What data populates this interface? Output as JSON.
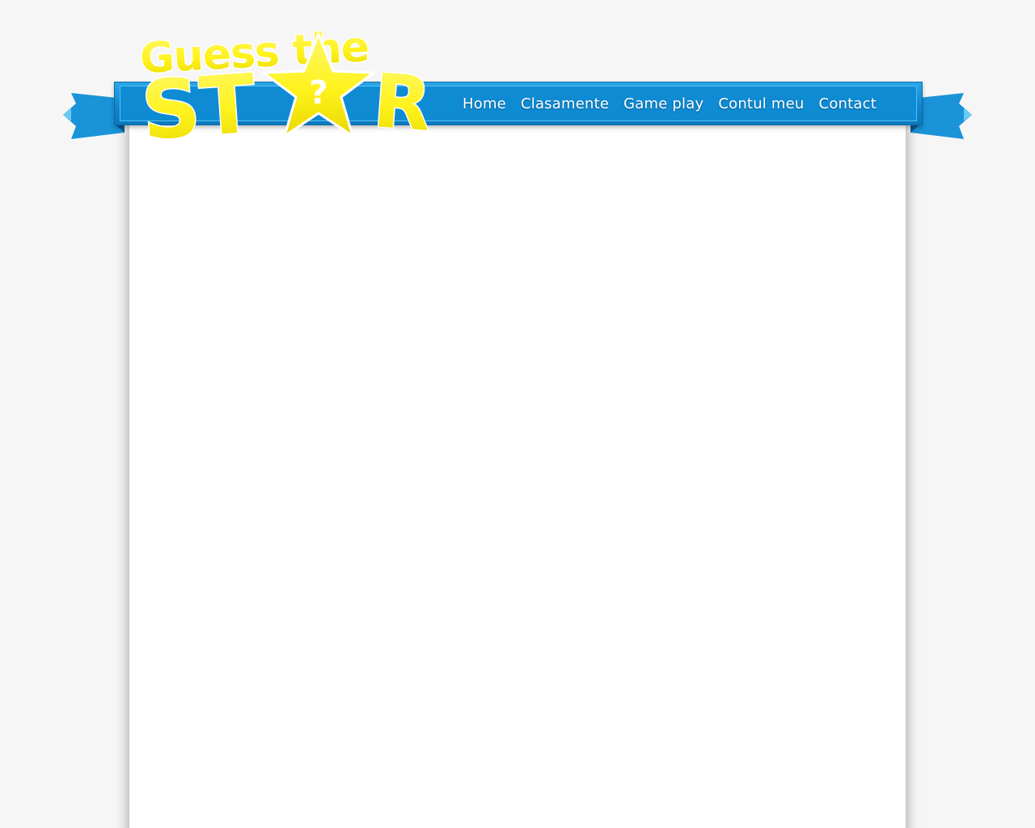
{
  "header": {
    "logo": {
      "line1": "Guess the",
      "line2": "STAR",
      "icon": "star-question-icon"
    },
    "nav": [
      {
        "label": "Home"
      },
      {
        "label": "Clasamente"
      },
      {
        "label": "Game play"
      },
      {
        "label": "Contul meu"
      },
      {
        "label": "Contact"
      }
    ]
  },
  "colors": {
    "background": "#f6f6f6",
    "ribbon": "#1187cf",
    "logo_yellow": "#fff21c",
    "panel": "#ffffff"
  }
}
